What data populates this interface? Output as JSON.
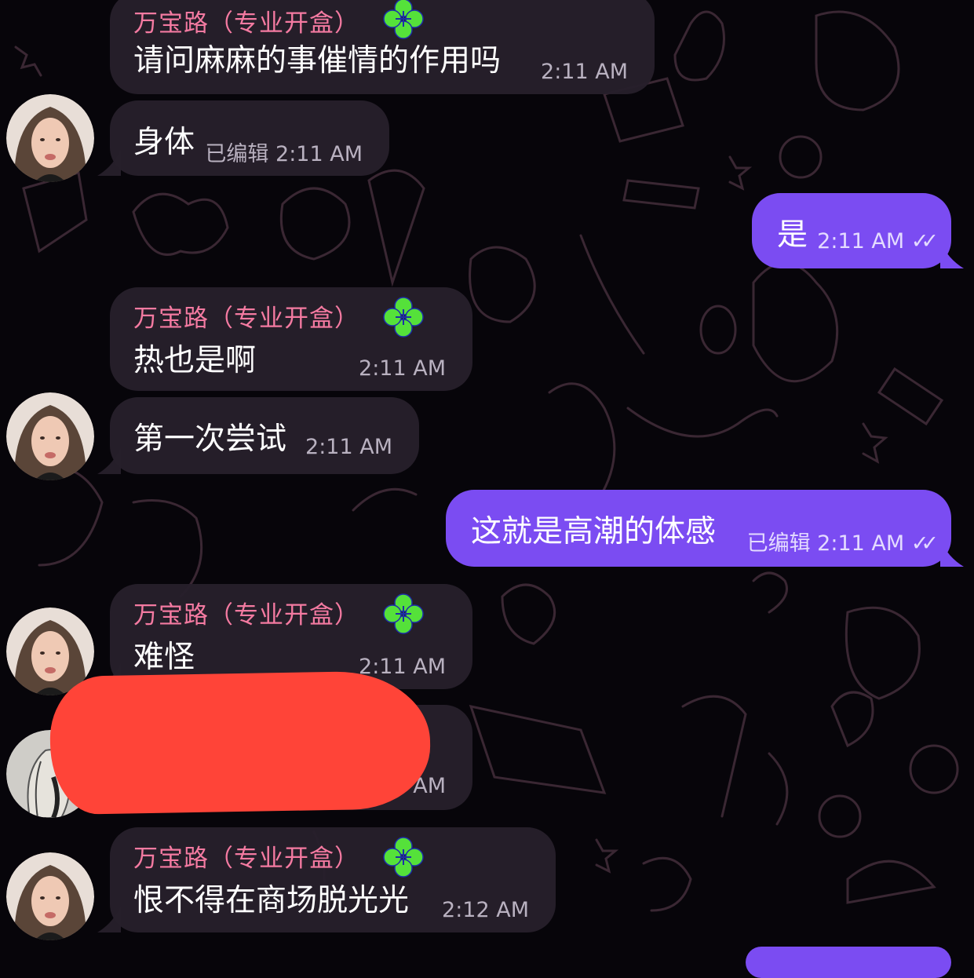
{
  "chat": {
    "messages": [
      {
        "sender": "万宝路（专业开盒）",
        "text": "请问麻麻的事催情的作用吗",
        "time": "2:11 AM"
      },
      {
        "text": "身体",
        "edited": "已编辑",
        "time": "2:11 AM"
      },
      {
        "text": "是",
        "time": "2:11 AM",
        "read": "✓✓"
      },
      {
        "sender": "万宝路（专业开盒）",
        "text": "热也是啊",
        "time": "2:11 AM"
      },
      {
        "text": "第一次尝试",
        "time": "2:11 AM"
      },
      {
        "text": "这就是高潮的体感",
        "edited": "已编辑",
        "time": "2:11 AM",
        "read": "✓✓"
      },
      {
        "sender": "万宝路（专业开盒）",
        "text": "难怪",
        "time": "2:11 AM"
      },
      {
        "time_partial": "AM"
      },
      {
        "sender": "万宝路（专业开盒）",
        "text": "恨不得在商场脱光光",
        "time": "2:12 AM"
      }
    ]
  },
  "colors": {
    "incoming_bubble": "#261f2b",
    "outgoing_bubble": "#7b4cf2",
    "sender_name": "#f47aa1",
    "clover": "#55e13a",
    "redaction": "#ff4438"
  },
  "icons": {
    "sender_badge": "clover-icon",
    "read_receipt": "double-check-icon"
  }
}
